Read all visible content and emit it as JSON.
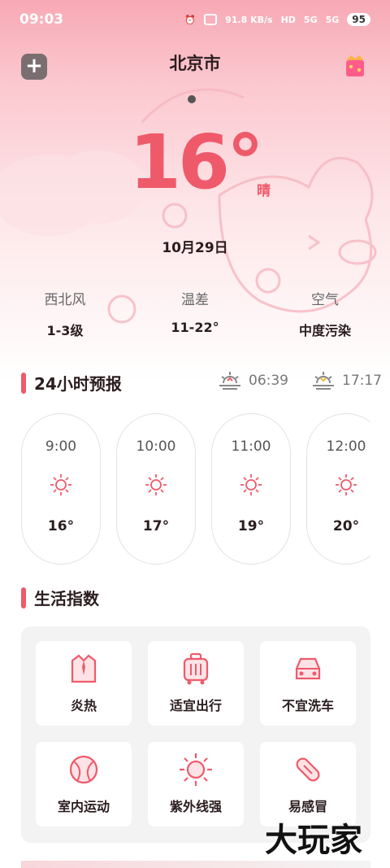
{
  "status_bar": {
    "time": "09:03",
    "network_speed": "91.8 KB/s",
    "hd": "HD",
    "signal_label_1": "5G",
    "signal_label_2": "5G",
    "battery": "95"
  },
  "header": {
    "city": "北京市"
  },
  "current": {
    "temperature": "16°",
    "condition": "晴",
    "date": "10月29日"
  },
  "metrics": [
    {
      "label": "西北风",
      "value": "1-3级"
    },
    {
      "label": "温差",
      "value": "11-22°"
    },
    {
      "label": "空气",
      "value": "中度污染"
    }
  ],
  "forecast_24h": {
    "title": "24小时预报",
    "sunrise": "06:39",
    "sunset": "17:17",
    "hours": [
      {
        "time": "9:00",
        "icon": "sun-icon",
        "temp": "16°"
      },
      {
        "time": "10:00",
        "icon": "sun-icon",
        "temp": "17°"
      },
      {
        "time": "11:00",
        "icon": "sun-icon",
        "temp": "19°"
      },
      {
        "time": "12:00",
        "icon": "sun-icon",
        "temp": "20°"
      }
    ]
  },
  "life_index": {
    "title": "生活指数",
    "items": [
      {
        "label": "炎热",
        "icon": "shirt-icon"
      },
      {
        "label": "适宜出行",
        "icon": "luggage-icon"
      },
      {
        "label": "不宜洗车",
        "icon": "car-icon"
      },
      {
        "label": "室内运动",
        "icon": "ball-icon"
      },
      {
        "label": "紫外线强",
        "icon": "uv-sun-icon"
      },
      {
        "label": "易感冒",
        "icon": "pill-icon"
      }
    ]
  },
  "watermark": "大玩家",
  "colors": {
    "accent": "#ef5a6a",
    "header_gradient_top": "#f7a9b5",
    "text_dark": "#2b1d1f"
  }
}
